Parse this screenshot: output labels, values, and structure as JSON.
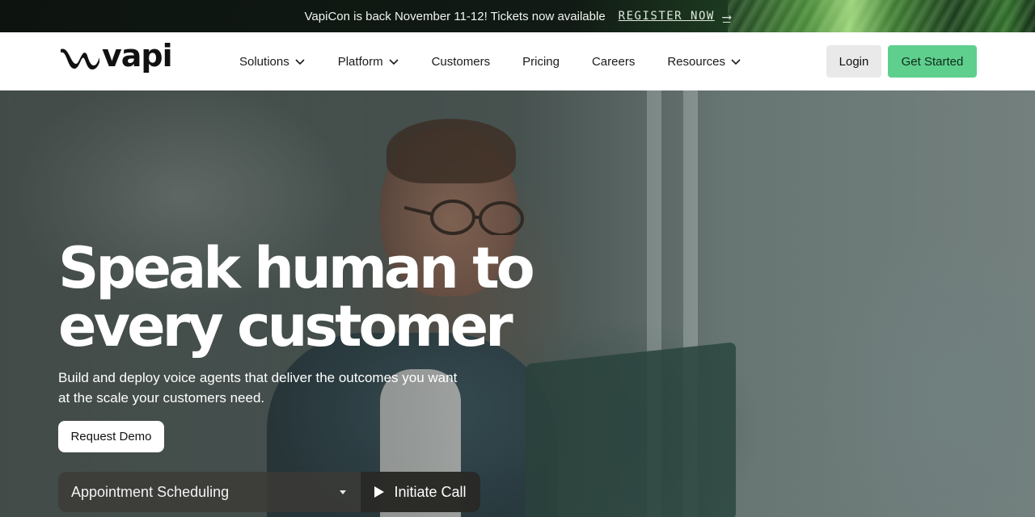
{
  "announcement": {
    "text": "VapiCon is back November 11-12! Tickets now available",
    "link_label": "REGISTER NOW",
    "arrow": "⟶"
  },
  "brand": {
    "name": "vapi",
    "accent_color": "#5fcf8e"
  },
  "nav": {
    "items": [
      {
        "label": "Solutions",
        "has_dropdown": true
      },
      {
        "label": "Platform",
        "has_dropdown": true
      },
      {
        "label": "Customers",
        "has_dropdown": false
      },
      {
        "label": "Pricing",
        "has_dropdown": false
      },
      {
        "label": "Careers",
        "has_dropdown": false
      },
      {
        "label": "Resources",
        "has_dropdown": true
      }
    ],
    "login_label": "Login",
    "cta_label": "Get Started"
  },
  "hero": {
    "title_line1": "Speak human to",
    "title_line2": "every customer",
    "subtitle": "Build and deploy voice agents that deliver the outcomes you want at the scale your customers need.",
    "demo_label": "Request Demo",
    "call": {
      "selected_use_case": "Appointment Scheduling",
      "button_label": "Initiate Call"
    }
  }
}
